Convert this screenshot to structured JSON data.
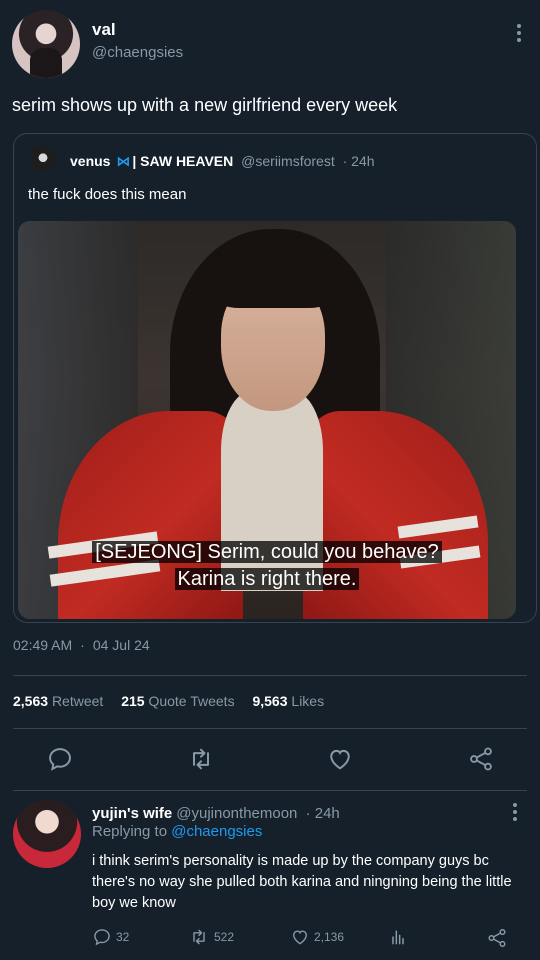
{
  "tweet": {
    "display_name": "val",
    "handle": "@chaengsies",
    "text": "serim shows up with a new girlfriend every week",
    "timestamp_time": "02:49 AM",
    "timestamp_sep": "·",
    "timestamp_date": "04 Jul 24"
  },
  "quote": {
    "name": "venus",
    "name_suffix": "| SAW HEAVEN",
    "handle": "@seriimsforest",
    "time": "· 24h",
    "text": "the fuck does this mean",
    "subtitle_line1": "[SEJEONG] Serim, could you behave?",
    "subtitle_line2": "Karina is right there."
  },
  "stats": {
    "retweets_count": "2,563",
    "retweets_label": "Retweet",
    "quotes_count": "215",
    "quotes_label": "Quote Tweets",
    "likes_count": "9,563",
    "likes_label": "Likes"
  },
  "icons": {
    "reply": "reply-icon",
    "retweet": "retweet-icon",
    "like": "heart-icon",
    "share": "share-icon",
    "more": "more-vertical-icon",
    "analytics": "analytics-icon"
  },
  "reply": {
    "name": "yujin's wife",
    "handle": "@yujinonthemoon",
    "time": "· 24h",
    "replying_prefix": "Replying to",
    "replying_mention": "@chaengsies",
    "text": "i think serim's personality is made up by the company guys bc there's no way she pulled both karina and ningning being the little boy we know",
    "reply_count": "32",
    "retweet_count": "522",
    "like_count": "2,136"
  },
  "colors": {
    "background": "#15202b",
    "secondary_text": "#8899a6",
    "accent": "#1d9bf0",
    "divider": "#38444d"
  }
}
